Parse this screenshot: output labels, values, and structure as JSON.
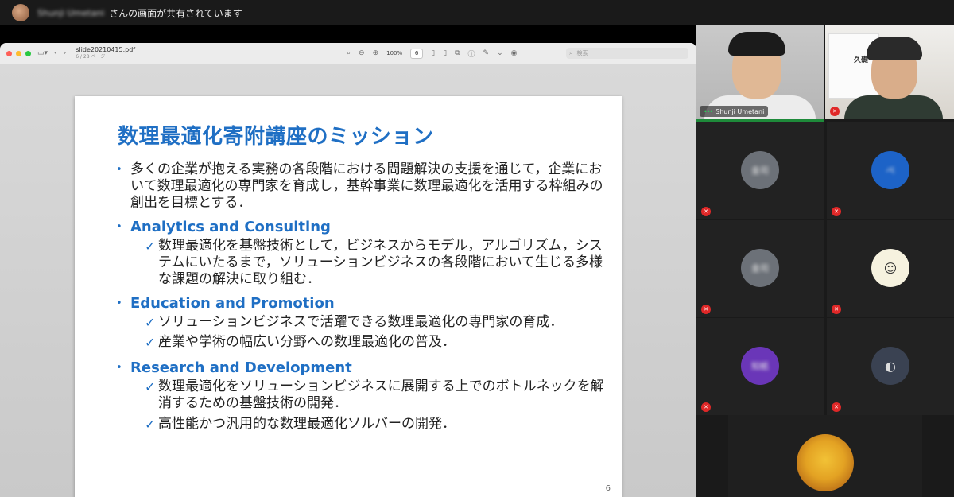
{
  "banner": {
    "presenter_name": "Shunji Umetani",
    "message": "さんの画面が共有されています"
  },
  "viewer": {
    "file_name": "slide20210415.pdf",
    "page_info": "6 / 28 ページ",
    "zoom": "100%",
    "page_field": "6",
    "search_placeholder": "検索"
  },
  "slide": {
    "title": "数理最適化寄附講座のミッション",
    "intro": "多くの企業が抱える実務の各段階における問題解決の支援を通じて，企業において数理最適化の専門家を育成し，基幹事業に数理最適化を活用する枠組みの創出を目標とする．",
    "sections": [
      {
        "heading": "Analytics and Consulting",
        "items": [
          "数理最適化を基盤技術として，ビジネスからモデル，アルゴリズム，システムにいたるまで，ソリューションビジネスの各段階において生じる多様な課題の解決に取り組む．"
        ]
      },
      {
        "heading": "Education and Promotion",
        "items": [
          "ソリューションビジネスで活躍できる数理最適化の専門家の育成．",
          "産業や学術の幅広い分野への数理最適化の普及．"
        ]
      },
      {
        "heading": "Research and Development",
        "items": [
          "数理最適化をソリューションビジネスに展開する上でのボトルネックを解消するための基盤技術の開発．",
          "高性能かつ汎用的な数理最適化ソルバーの開発．"
        ]
      }
    ],
    "page_number": "6"
  },
  "participants": {
    "video1_name": "Shunji Umetani",
    "video2_sign": "久礎",
    "tiles": [
      {
        "initials": "金司",
        "color": "#6c7178"
      },
      {
        "initials": "ペ",
        "color": "#1d63c7"
      },
      {
        "initials": "金司",
        "color": "#6c7178"
      },
      {
        "initials": "",
        "color": "#f6f2df"
      },
      {
        "initials": "知紙",
        "color": "#6a36b8"
      },
      {
        "initials": "",
        "color": "#3a4252"
      }
    ]
  }
}
